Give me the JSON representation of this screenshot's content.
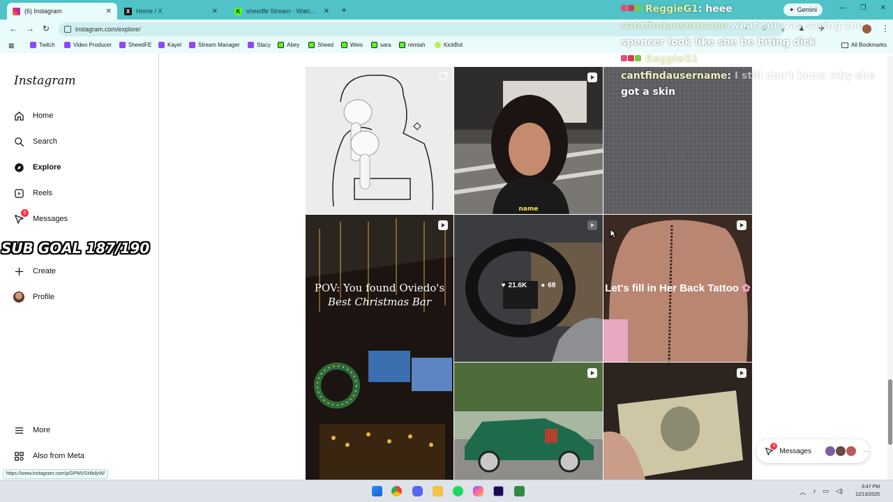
{
  "browser": {
    "tabs": [
      {
        "title": "(6) Instagram",
        "icon": "instagram-icon",
        "active": true
      },
      {
        "title": "Home / X",
        "icon": "x-icon",
        "active": false
      },
      {
        "title": "sheedfe Stream - Watch Live on",
        "icon": "kick-icon",
        "active": false
      }
    ],
    "new_tab": "+",
    "gemini": "Gemini",
    "url": "instagram.com/explore/",
    "bookmarks": [
      "Twitch",
      "Video Producer",
      "SheedFE",
      "Kayel",
      "Stream Manager",
      "Stacy",
      "Abey",
      "Sheed",
      "Weio",
      "sara",
      "remiah",
      "KickBot"
    ],
    "all_bookmarks": "All Bookmarks",
    "status_url": "https://www.instagram.com/p/DPMVSHbdyW/"
  },
  "sidebar": {
    "logo": "Instagram",
    "items": [
      {
        "label": "Home",
        "icon": "home-icon"
      },
      {
        "label": "Search",
        "icon": "search-icon"
      },
      {
        "label": "Explore",
        "icon": "compass-icon"
      },
      {
        "label": "Reels",
        "icon": "reels-icon"
      },
      {
        "label": "Messages",
        "icon": "messenger-icon",
        "badge": "6"
      },
      {
        "label": "Create",
        "icon": "plus-icon"
      },
      {
        "label": "Profile",
        "icon": "profile-avatar"
      }
    ],
    "more": "More",
    "also_from_meta": "Also from Meta"
  },
  "overlay": {
    "sub_goal": "SUB GOAL 187/190"
  },
  "grid": {
    "posts": [
      {
        "kind": "carousel",
        "overlay": ""
      },
      {
        "kind": "reel",
        "overlay": "name"
      },
      {
        "kind": "image",
        "overlay": ""
      },
      {
        "kind": "reel",
        "overlay_line1": "POV: You found Oviedo's",
        "overlay_line2": "Best Christmas Bar"
      },
      {
        "kind": "reel",
        "likes": "21.6K",
        "comments": "68"
      },
      {
        "kind": "reel",
        "overlay": "Let's fill in Her Back Tattoo"
      },
      {
        "kind": "reel",
        "overlay": ""
      },
      {
        "kind": "reel",
        "overlay": ""
      },
      {
        "kind": "reel",
        "overlay": ""
      }
    ]
  },
  "messages_pill": {
    "label": "Messages",
    "badge": "6"
  },
  "chat": [
    {
      "user": "ReggieG1",
      "sep": ":",
      "text": "heee"
    },
    {
      "user": "cantfindausername",
      "sep": "",
      "text": "what sol was saying zoe"
    },
    {
      "user": "",
      "sep": "",
      "text": "spencer look like she be biting dick"
    },
    {
      "user": "ReggieG1",
      "sep": "",
      "text": ""
    },
    {
      "user": "cantfindausername",
      "sep": ":",
      "text": "I still don't know why she"
    },
    {
      "user": "",
      "sep": "",
      "text": "got a skin"
    }
  ],
  "clock": {
    "time": "3:47 PM",
    "date": "12/13/2025"
  },
  "colors": {
    "tabstrip": "#4fc3c7",
    "toolbar": "#e9fbfb",
    "instagram_badge": "#ff3040"
  }
}
